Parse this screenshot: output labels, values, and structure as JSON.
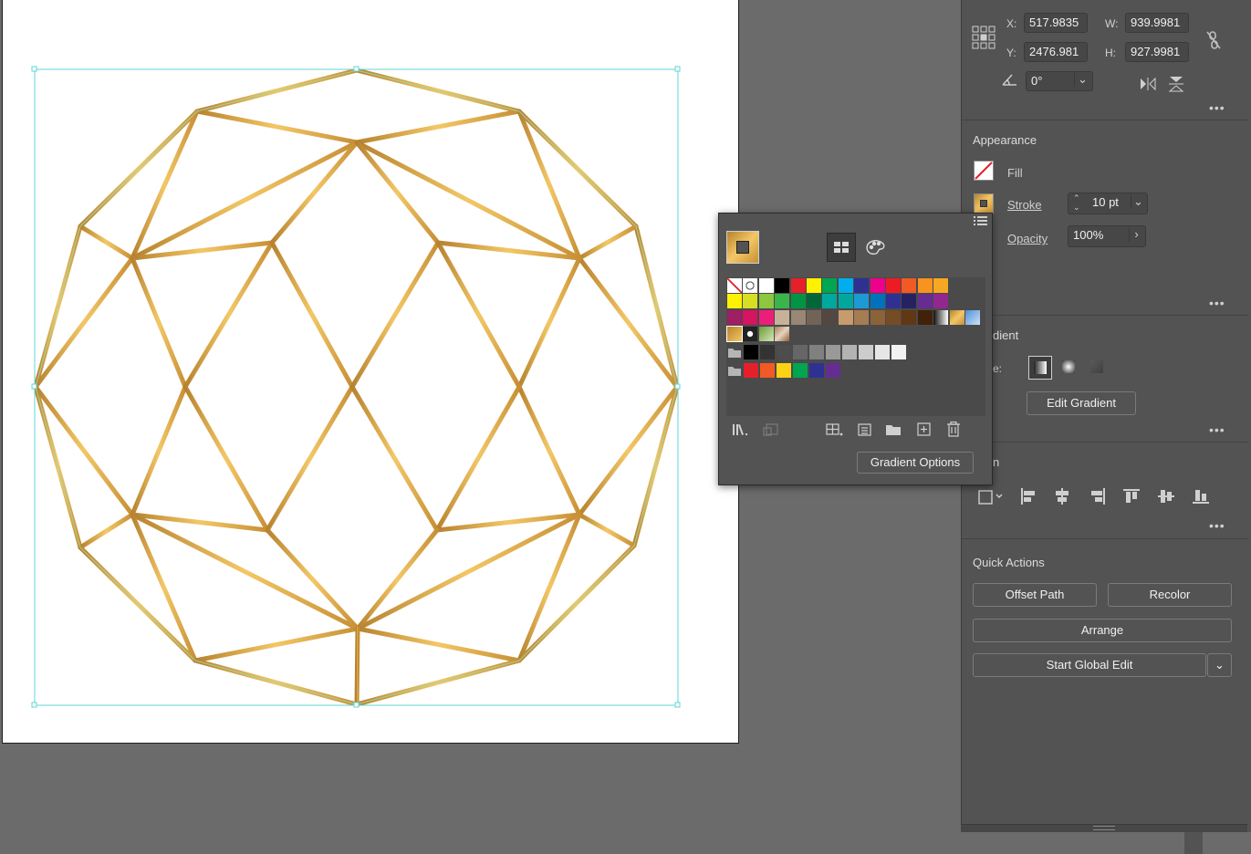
{
  "transform": {
    "x_label": "X:",
    "x_value": "517.9835",
    "y_label": "Y:",
    "y_value": "2476.981",
    "w_label": "W:",
    "w_value": "939.9981",
    "h_label": "H:",
    "h_value": "927.9981",
    "angle_value": "0°"
  },
  "appearance": {
    "title": "Appearance",
    "fill_label": "Fill",
    "stroke_label": "Stroke",
    "stroke_weight": "10 pt",
    "opacity_label": "Opacity",
    "opacity_value": "100%"
  },
  "gradient": {
    "title_partial": "dient",
    "type_label_partial": "e:",
    "edit_button": "Edit Gradient"
  },
  "align": {
    "title_partial": "n"
  },
  "quick_actions": {
    "title": "Quick Actions",
    "offset_path": "Offset Path",
    "recolor": "Recolor",
    "arrange": "Arrange",
    "start_global_edit": "Start Global Edit"
  },
  "swatches_popup": {
    "gradient_options_button": "Gradient Options",
    "rows": [
      [
        "none",
        "register",
        "#ffffff",
        "#000000",
        "#e5202a",
        "#fff200",
        "#00a651",
        "#00aeef",
        "#2e3192",
        "#ec008c",
        "#ed1c24",
        "#f15a24",
        "#f7931e",
        "#f7a823"
      ],
      [
        "#fff200",
        "#d7df23",
        "#8dc63f",
        "#39b54a",
        "#009444",
        "#006838",
        "#00a99d",
        "#00a79d",
        "#1b9ad6",
        "#0072bc",
        "#2e3192",
        "#262262",
        "#662d91",
        "#92278f"
      ],
      [
        "#9e1f63",
        "#d6145f",
        "#ed1e79",
        "#c7b299",
        "#998675",
        "#736357",
        "#534741",
        "#c69c6d",
        "#a67c52",
        "#8c6239",
        "#754c24",
        "#603813",
        "#42210b",
        "gradient-bw"
      ],
      [
        "gradient-gold",
        "gradient-blue"
      ],
      [
        "pattern-gold",
        "pattern-dots",
        "pattern-leaf",
        "pattern-marble"
      ],
      [
        "#000000",
        "#333333",
        "#4d4d4d",
        "#666666",
        "#808080",
        "#999999",
        "#b3b3b3",
        "#cccccc",
        "#e6e6e6",
        "#f2f2f2"
      ],
      [
        "#e5202a",
        "#f15a24",
        "#fcd116",
        "#00a651",
        "#2e3192",
        "#662d91"
      ]
    ]
  },
  "icons": {
    "transform_reference": "reference-point-icon",
    "constrain": "link-broken-icon",
    "angle": "angle-icon",
    "flip_h": "flip-horizontal-icon",
    "flip_v": "flip-vertical-icon",
    "library": "swatch-library-icon",
    "place": "place-swatch-icon",
    "show_kinds": "show-kinds-icon",
    "options": "swatch-options-icon",
    "new_group": "new-group-icon",
    "new_swatch": "new-swatch-icon",
    "delete": "delete-icon"
  }
}
